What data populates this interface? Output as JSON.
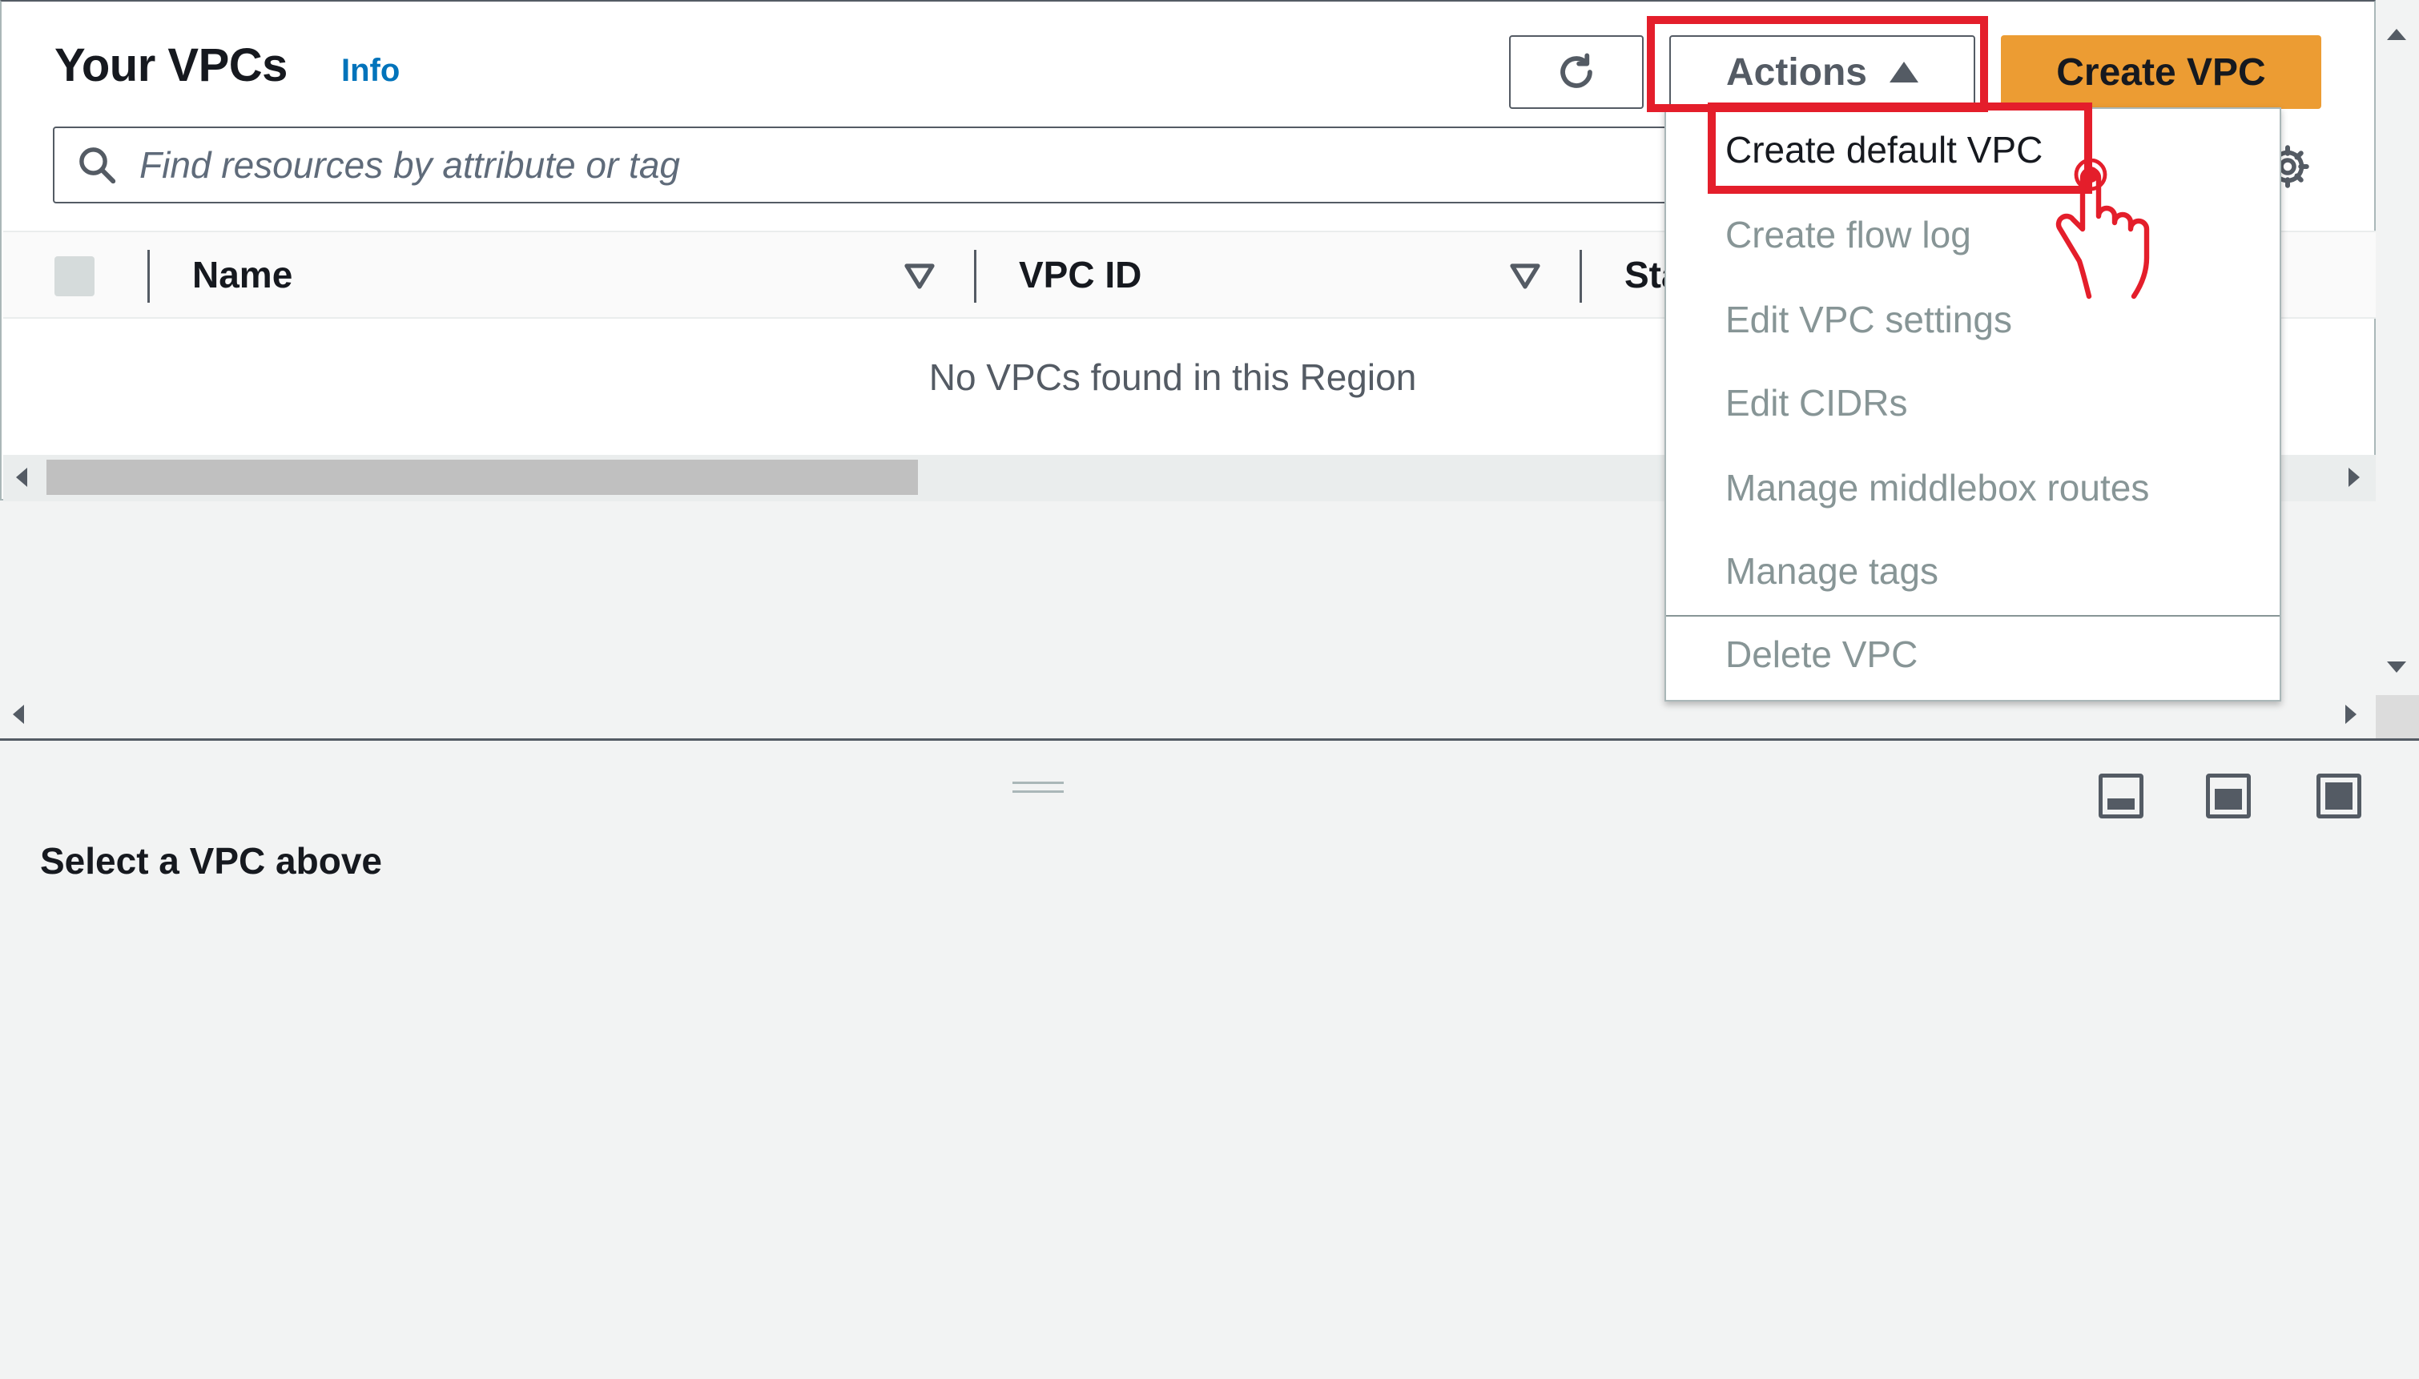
{
  "header": {
    "title": "Your VPCs",
    "info_link": "Info",
    "actions_label": "Actions",
    "create_label": "Create VPC"
  },
  "search": {
    "placeholder": "Find resources by attribute or tag"
  },
  "table": {
    "columns": [
      "Name",
      "VPC ID",
      "Sta"
    ],
    "empty_message": "No VPCs found in this Region"
  },
  "actions_menu": {
    "items": [
      {
        "label": "Create default VPC",
        "enabled": true
      },
      {
        "label": "Create flow log",
        "enabled": false
      },
      {
        "label": "Edit VPC settings",
        "enabled": false
      },
      {
        "label": "Edit CIDRs",
        "enabled": false
      },
      {
        "label": "Manage middlebox routes",
        "enabled": false
      },
      {
        "label": "Manage tags",
        "enabled": false
      },
      {
        "label": "Delete VPC",
        "enabled": false
      }
    ]
  },
  "details": {
    "message": "Select a VPC above"
  },
  "colors": {
    "primary_button": "#ec9c33",
    "link": "#0073bb",
    "highlight": "#e41e2b",
    "disabled_text": "#879596"
  }
}
